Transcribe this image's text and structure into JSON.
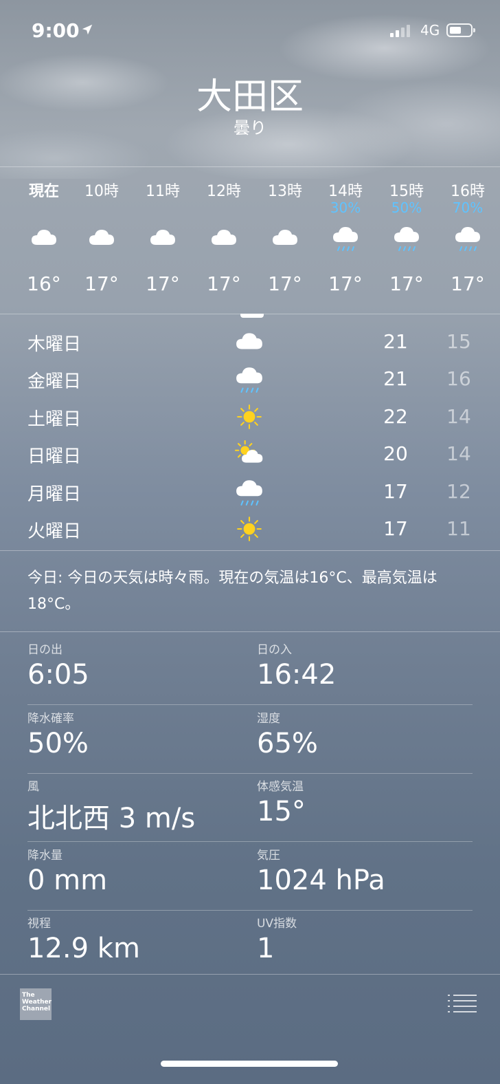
{
  "status": {
    "time": "9:00",
    "network": "4G",
    "icons": [
      "location-arrow-icon",
      "signal-icon",
      "battery-icon"
    ]
  },
  "header": {
    "city": "大田区",
    "condition": "曇り"
  },
  "hourly": [
    {
      "label": "現在",
      "prob": "",
      "icon": "cloud-icon",
      "temp": "16°"
    },
    {
      "label": "10時",
      "prob": "",
      "icon": "cloud-icon",
      "temp": "17°"
    },
    {
      "label": "11時",
      "prob": "",
      "icon": "cloud-icon",
      "temp": "17°"
    },
    {
      "label": "12時",
      "prob": "",
      "icon": "cloud-icon",
      "temp": "17°"
    },
    {
      "label": "13時",
      "prob": "",
      "icon": "cloud-icon",
      "temp": "17°"
    },
    {
      "label": "14時",
      "prob": "30%",
      "icon": "cloud-rain-icon",
      "temp": "17°"
    },
    {
      "label": "15時",
      "prob": "50%",
      "icon": "cloud-rain-icon",
      "temp": "17°"
    },
    {
      "label": "16時",
      "prob": "70%",
      "icon": "cloud-rain-icon",
      "temp": "17°"
    }
  ],
  "daily": [
    {
      "day": "木曜日",
      "icon": "cloud-icon",
      "high": "21",
      "low": "15"
    },
    {
      "day": "金曜日",
      "icon": "cloud-rain-icon",
      "high": "21",
      "low": "16"
    },
    {
      "day": "土曜日",
      "icon": "sun-icon",
      "high": "22",
      "low": "14"
    },
    {
      "day": "日曜日",
      "icon": "sun-cloud-icon",
      "high": "20",
      "low": "14"
    },
    {
      "day": "月曜日",
      "icon": "cloud-rain-icon",
      "high": "17",
      "low": "12"
    },
    {
      "day": "火曜日",
      "icon": "sun-icon",
      "high": "17",
      "low": "11"
    }
  ],
  "summary": "今日: 今日の天気は時々雨。現在の気温は16°C、最高気温は18°C。",
  "details": [
    {
      "left_label": "日の出",
      "left_value": "6:05",
      "right_label": "日の入",
      "right_value": "16:42"
    },
    {
      "left_label": "降水確率",
      "left_value": "50%",
      "right_label": "湿度",
      "right_value": "65%"
    },
    {
      "left_label": "風",
      "left_value": "北北西 3 m/s",
      "right_label": "体感気温",
      "right_value": "15°"
    },
    {
      "left_label": "降水量",
      "left_value": "0 mm",
      "right_label": "気圧",
      "right_value": "1024 hPa"
    },
    {
      "left_label": "視程",
      "left_value": "12.9 km",
      "right_label": "UV指数",
      "right_value": "1"
    }
  ],
  "footer": {
    "logo_text": "The Weather Channel",
    "list_icon": "list-icon"
  },
  "colors": {
    "precip": "#5fc3ff",
    "sun": "#ffd21f"
  }
}
